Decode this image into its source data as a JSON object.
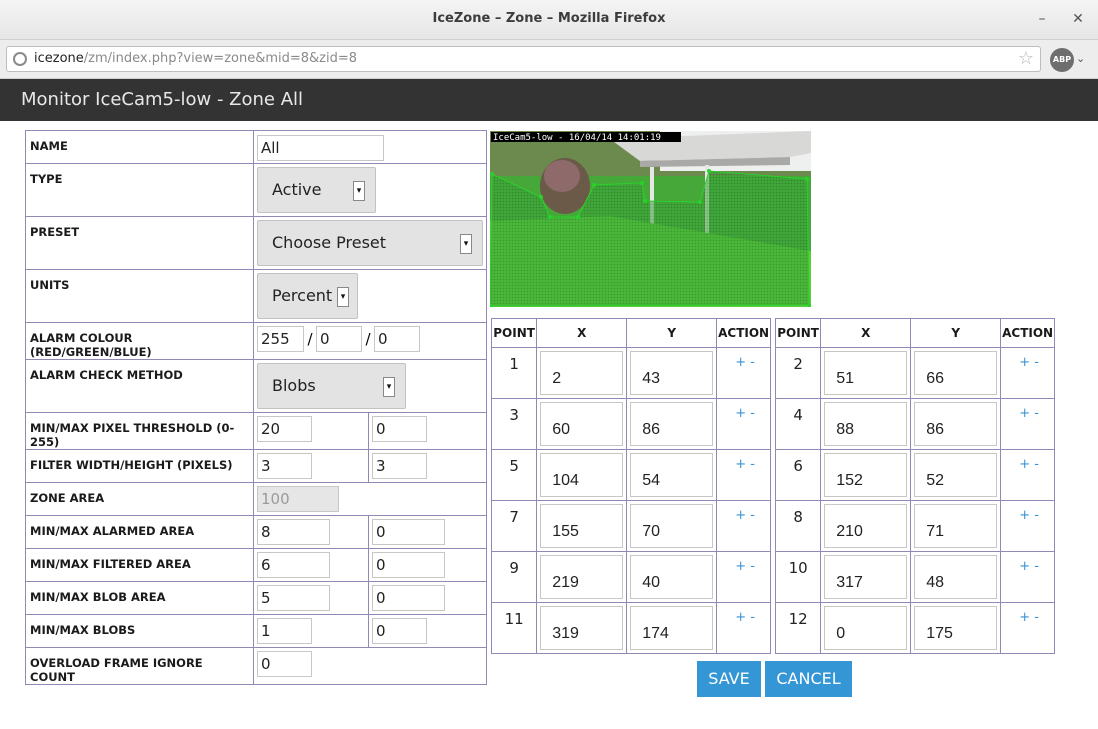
{
  "window": {
    "title": "IceZone – Zone – Mozilla Firefox",
    "minimize": "–",
    "close": "✕"
  },
  "urlbar": {
    "host": "icezone",
    "path": "/zm/index.php?view=zone&mid=8&zid=8",
    "star": "☆",
    "abp": "ABP",
    "abp_arrow": "⌄"
  },
  "header": {
    "title": "Monitor IceCam5-low - Zone All"
  },
  "form": {
    "name_label": "NAME",
    "name_value": "All",
    "type_label": "TYPE",
    "type_value": "Active",
    "preset_label": "PRESET",
    "preset_value": "Choose Preset",
    "units_label": "UNITS",
    "units_value": "Percent",
    "alarm_colour_label": "ALARM COLOUR (RED/GREEN/BLUE)",
    "alarm_red": "255",
    "alarm_green": "0",
    "alarm_blue": "0",
    "slash": "/",
    "check_method_label": "ALARM CHECK METHOD",
    "check_method_value": "Blobs",
    "pixel_threshold_label": "MIN/MAX PIXEL THRESHOLD (0-255)",
    "pixel_threshold_min": "20",
    "pixel_threshold_max": "0",
    "filter_label": "FILTER WIDTH/HEIGHT (PIXELS)",
    "filter_width": "3",
    "filter_height": "3",
    "zone_area_label": "ZONE AREA",
    "zone_area_value": "100",
    "alarmed_area_label": "MIN/MAX ALARMED AREA",
    "alarmed_area_min": "8",
    "alarmed_area_max": "0",
    "filtered_area_label": "MIN/MAX FILTERED AREA",
    "filtered_area_min": "6",
    "filtered_area_max": "0",
    "blob_area_label": "MIN/MAX BLOB AREA",
    "blob_area_min": "5",
    "blob_area_max": "0",
    "blobs_label": "MIN/MAX BLOBS",
    "blobs_min": "1",
    "blobs_max": "0",
    "overload_label": "OVERLOAD FRAME IGNORE COUNT",
    "overload_value": "0",
    "dropdown_arrow": "▾"
  },
  "image": {
    "overlay_text": "IceCam5-low - 16/04/14 14:01:19"
  },
  "points": {
    "headers": {
      "point": "POINT",
      "x": "X",
      "y": "Y",
      "action": "ACTION"
    },
    "action_text": "+ -",
    "left": [
      {
        "point": "1",
        "x": "2",
        "y": "43"
      },
      {
        "point": "3",
        "x": "60",
        "y": "86"
      },
      {
        "point": "5",
        "x": "104",
        "y": "54"
      },
      {
        "point": "7",
        "x": "155",
        "y": "70"
      },
      {
        "point": "9",
        "x": "219",
        "y": "40"
      },
      {
        "point": "11",
        "x": "319",
        "y": "174"
      }
    ],
    "right": [
      {
        "point": "2",
        "x": "51",
        "y": "66"
      },
      {
        "point": "4",
        "x": "88",
        "y": "86"
      },
      {
        "point": "6",
        "x": "152",
        "y": "52"
      },
      {
        "point": "8",
        "x": "210",
        "y": "71"
      },
      {
        "point": "10",
        "x": "317",
        "y": "48"
      },
      {
        "point": "12",
        "x": "0",
        "y": "175"
      }
    ]
  },
  "buttons": {
    "save": "SAVE",
    "cancel": "CANCEL"
  },
  "colors": {
    "header_bg": "#333333",
    "accent": "#3596d6",
    "border": "#8f8ab5"
  }
}
